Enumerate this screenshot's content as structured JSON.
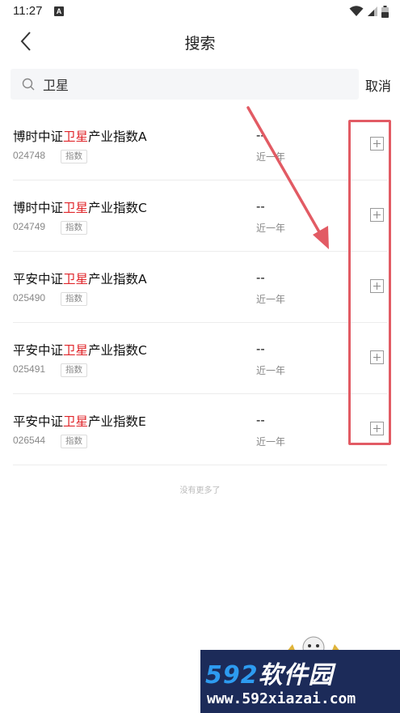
{
  "status_bar": {
    "time": "11:27",
    "notification_badge": "A"
  },
  "nav": {
    "title": "搜索"
  },
  "search": {
    "value": "卫星",
    "cancel_label": "取消"
  },
  "results": [
    {
      "name_prefix": "博时中证",
      "name_highlight": "卫星",
      "name_suffix": "产业指数A",
      "code": "024748",
      "tag": "指数",
      "value": "--",
      "period": "近一年"
    },
    {
      "name_prefix": "博时中证",
      "name_highlight": "卫星",
      "name_suffix": "产业指数C",
      "code": "024749",
      "tag": "指数",
      "value": "--",
      "period": "近一年"
    },
    {
      "name_prefix": "平安中证",
      "name_highlight": "卫星",
      "name_suffix": "产业指数A",
      "code": "025490",
      "tag": "指数",
      "value": "--",
      "period": "近一年"
    },
    {
      "name_prefix": "平安中证",
      "name_highlight": "卫星",
      "name_suffix": "产业指数C",
      "code": "025491",
      "tag": "指数",
      "value": "--",
      "period": "近一年"
    },
    {
      "name_prefix": "平安中证",
      "name_highlight": "卫星",
      "name_suffix": "产业指数E",
      "code": "026544",
      "tag": "指数",
      "value": "--",
      "period": "近一年"
    }
  ],
  "footer": {
    "end_text": "没有更多了"
  },
  "watermark": {
    "brand_num": "592",
    "brand_text": "软件园",
    "url": "www.592xiazai.com"
  },
  "colors": {
    "highlight": "#e0262b",
    "annotation": "#e25b64",
    "watermark_bg": "#1c2b59",
    "watermark_accent": "#2d9bf0"
  }
}
